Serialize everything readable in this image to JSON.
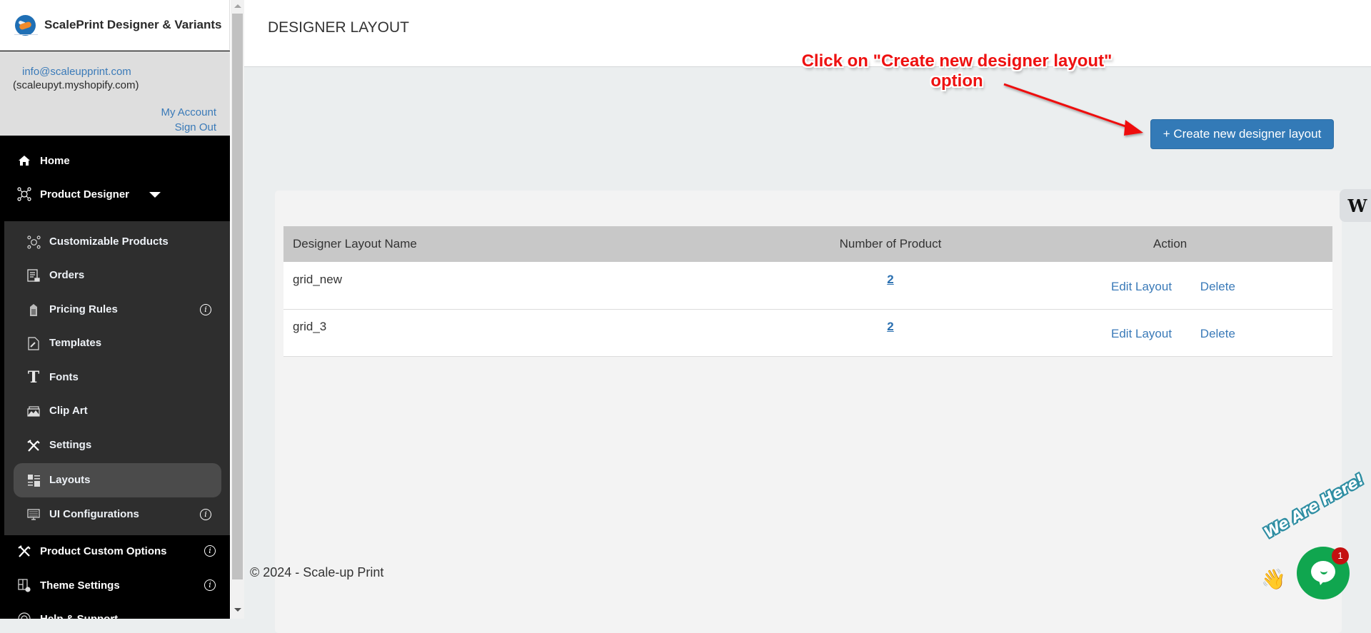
{
  "sidebar": {
    "brand_title": "ScalePrint Designer & Variants",
    "account": {
      "email": "info@scaleupprint.com",
      "store_domain": "(scaleupyt.myshopify.com)",
      "my_account_label": "My Account",
      "sign_out_label": "Sign Out"
    },
    "top_items": [
      {
        "label": "Home",
        "icon": "home-icon"
      },
      {
        "label": "Product Designer",
        "icon": "network-icon",
        "expanded": true
      }
    ],
    "sub_items": [
      {
        "label": "Customizable Products",
        "icon": "network-icon",
        "info": false
      },
      {
        "label": "Orders",
        "icon": "receipt-icon",
        "info": false
      },
      {
        "label": "Pricing Rules",
        "icon": "price-tag-icon",
        "info": true
      },
      {
        "label": "Templates",
        "icon": "document-edit-icon",
        "info": false
      },
      {
        "label": "Fonts",
        "icon": "font-icon",
        "info": false
      },
      {
        "label": "Clip Art",
        "icon": "image-stack-icon",
        "info": false
      },
      {
        "label": "Settings",
        "icon": "tools-icon",
        "info": false
      },
      {
        "label": "Layouts",
        "icon": "layout-icon",
        "info": false,
        "active": true
      },
      {
        "label": "UI Configurations",
        "icon": "monitor-icon",
        "info": true
      }
    ],
    "bottom_items": [
      {
        "label": "Product Custom Options",
        "icon": "tools-icon",
        "info": true
      },
      {
        "label": "Theme Settings",
        "icon": "theme-settings-icon",
        "info": true
      },
      {
        "label": "Help & Support",
        "icon": "lifebuoy-icon",
        "info": false
      }
    ],
    "info_glyph": "i"
  },
  "header": {
    "page_title": "DESIGNER LAYOUT"
  },
  "toolbar": {
    "create_label": "+ Create new designer layout"
  },
  "table": {
    "columns": [
      "Designer Layout Name",
      "Number of Product",
      "Action"
    ],
    "rows": [
      {
        "name": "grid_new",
        "count": "2",
        "edit_label": "Edit Layout",
        "delete_label": "Delete"
      },
      {
        "name": "grid_3",
        "count": "2",
        "edit_label": "Edit Layout",
        "delete_label": "Delete"
      }
    ]
  },
  "footer": {
    "text": "© 2024 - Scale-up Print"
  },
  "annotation": {
    "line1": "Click on \"Create new designer layout\"",
    "line2": "option"
  },
  "widgets": {
    "side_badge_glyph": "W",
    "chat_tagline": "We Are Here!",
    "chat_unread_count": "1",
    "wave_glyph": "👋"
  },
  "colors": {
    "primary_button": "#337ab7",
    "link": "#3a7ab8",
    "annotation_red": "#ee1111",
    "chat_green": "#10a64f",
    "badge_red": "#c41010"
  }
}
